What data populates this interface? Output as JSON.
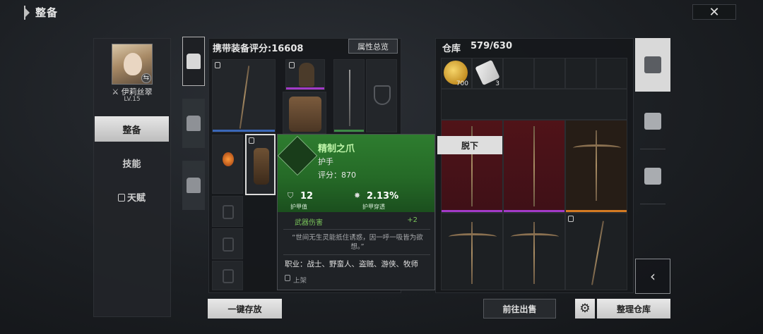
{
  "header": {
    "title": "整备",
    "close_icon": "close-icon"
  },
  "character": {
    "name": "伊莉丝翠",
    "level": "LV.15"
  },
  "sidebar": {
    "items": [
      {
        "label": "整备",
        "active": true
      },
      {
        "label": "技能",
        "active": false
      },
      {
        "label": "天赋",
        "active": false,
        "locked": true
      }
    ]
  },
  "equipment": {
    "title": "携带装备评分:16608",
    "attr_button": "属性总览"
  },
  "tooltip": {
    "name": "精制之爪",
    "type": "护手",
    "score": "评分：870",
    "armor_value": "12",
    "armor_label": "护甲值",
    "pen_value": "2.13%",
    "pen_label": "护甲穿透",
    "attr_name": "武器伤害",
    "attr_value": "+2",
    "quote": "“世间无生灵能抵住诱惑，因一呼一吸皆为欲想。”",
    "classes": "职业：战士、野蛮人、盗贼、游侠、牧师",
    "listing": "上架"
  },
  "warehouse": {
    "title": "仓库",
    "count": "579/630",
    "items": [
      {
        "name": "gold-coin",
        "qty": "700"
      },
      {
        "name": "scroll",
        "qty": "3"
      }
    ],
    "unequip_button": "脱下"
  },
  "buttons": {
    "store_all": "一键存放",
    "go_sell": "前往出售",
    "organize": "整理仓库"
  },
  "colors": {
    "rarity_green": "#2e7d2f",
    "rarity_blue": "#3a67b8",
    "rarity_purple": "#a23ac7",
    "rarity_orange": "#d37a22",
    "accent_light": "#dedede"
  }
}
